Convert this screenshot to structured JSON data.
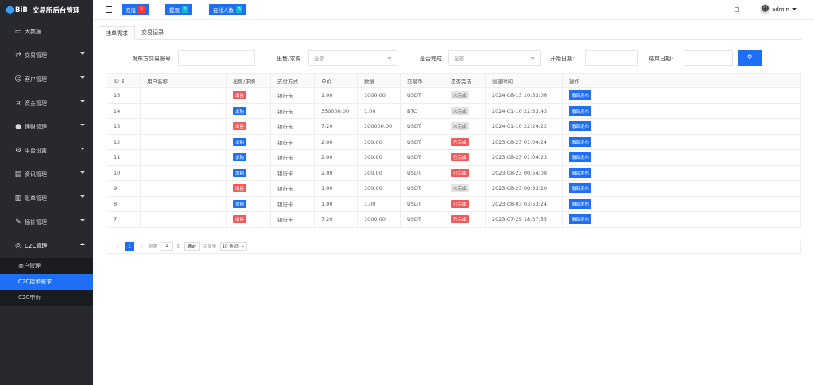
{
  "brand": {
    "logo_text": "BiB",
    "title": "交易所后台管理"
  },
  "sidebar": {
    "items": [
      {
        "label": "大数据",
        "icon": "monitor-icon",
        "has_children": false
      },
      {
        "label": "交易管理",
        "icon": "exchange-icon",
        "has_children": true
      },
      {
        "label": "客户管理",
        "icon": "users-icon",
        "has_children": true
      },
      {
        "label": "资金管理",
        "icon": "money-icon",
        "has_children": true
      },
      {
        "label": "理财管理",
        "icon": "piggy-bank-icon",
        "has_children": true
      },
      {
        "label": "平台设置",
        "icon": "settings-icon",
        "has_children": true
      },
      {
        "label": "资讯管理",
        "icon": "news-icon",
        "has_children": true
      },
      {
        "label": "账单管理",
        "icon": "bill-icon",
        "has_children": true
      },
      {
        "label": "插针管理",
        "icon": "pin-icon",
        "has_children": true
      },
      {
        "label": "C2C管理",
        "icon": "c2c-icon",
        "has_children": true,
        "open": true
      }
    ],
    "sub_items": [
      {
        "label": "商户管理",
        "active": false
      },
      {
        "label": "C2C挂单需求",
        "active": true
      },
      {
        "label": "C2C申诉",
        "active": false
      }
    ]
  },
  "topbar": {
    "recharge_label": "充值",
    "recharge_count": "3",
    "withdraw_label": "提现",
    "withdraw_count": "1",
    "online_label": "在线人数",
    "online_count": "0",
    "user": "admin"
  },
  "tabs": [
    "挂单需求",
    "交易记录"
  ],
  "filters": {
    "account_label": "发布方交易账号",
    "account_value": "",
    "type_label": "出售/求购",
    "type_value": "全部",
    "done_label": "是否完成",
    "done_value": "全部",
    "start_label": "开始日期:",
    "end_label": "结束日期:"
  },
  "table": {
    "headers": [
      "ID ⇕",
      "用户名称",
      "出售/求购",
      "支付方式",
      "单价",
      "数量",
      "交易币",
      "是否完成",
      "创建时间",
      "操作"
    ],
    "rows": [
      {
        "id": "15",
        "user": "",
        "side": "出售",
        "side_type": "sell",
        "pay": "银行卡",
        "price": "1.00",
        "qty": "1000.00",
        "coin": "USDT",
        "done": "未完成",
        "done_type": "no",
        "time": "2024-08-13 10:53:06",
        "action": "撤回发布"
      },
      {
        "id": "14",
        "user": "",
        "side": "求购",
        "side_type": "buy",
        "pay": "银行卡",
        "price": "350000.00",
        "qty": "1.00",
        "coin": "BTC",
        "done": "未完成",
        "done_type": "no",
        "time": "2024-01-10 22:33:43",
        "action": "撤回发布"
      },
      {
        "id": "13",
        "user": "",
        "side": "出售",
        "side_type": "sell",
        "pay": "银行卡",
        "price": "7.20",
        "qty": "100000.00",
        "coin": "USDT",
        "done": "未完成",
        "done_type": "no",
        "time": "2024-01-10 22:24:22",
        "action": "撤回发布"
      },
      {
        "id": "12",
        "user": "",
        "side": "求购",
        "side_type": "buy",
        "pay": "银行卡",
        "price": "2.00",
        "qty": "100.00",
        "coin": "USDT",
        "done": "已完成",
        "done_type": "yes",
        "time": "2023-08-23 01:04:24",
        "action": "撤回发布"
      },
      {
        "id": "11",
        "user": "",
        "side": "求购",
        "side_type": "buy",
        "pay": "银行卡",
        "price": "2.00",
        "qty": "100.00",
        "coin": "USDT",
        "done": "已完成",
        "done_type": "yes",
        "time": "2023-08-23 01:04:23",
        "action": "撤回发布"
      },
      {
        "id": "10",
        "user": "",
        "side": "求购",
        "side_type": "buy",
        "pay": "银行卡",
        "price": "2.00",
        "qty": "100.00",
        "coin": "USDT",
        "done": "已完成",
        "done_type": "yes",
        "time": "2023-08-23 00:54:08",
        "action": "撤回发布"
      },
      {
        "id": "9",
        "user": "",
        "side": "出售",
        "side_type": "sell",
        "pay": "银行卡",
        "price": "1.00",
        "qty": "100.00",
        "coin": "USDT",
        "done": "未完成",
        "done_type": "no",
        "time": "2023-08-23 00:53:10",
        "action": "撤回发布"
      },
      {
        "id": "8",
        "user": "",
        "side": "求购",
        "side_type": "buy",
        "pay": "银行卡",
        "price": "1.00",
        "qty": "1.00",
        "coin": "USDT",
        "done": "已完成",
        "done_type": "yes",
        "time": "2023-08-03 03:53:24",
        "action": "撤回发布"
      },
      {
        "id": "7",
        "user": "",
        "side": "出售",
        "side_type": "sell",
        "pay": "银行卡",
        "price": "7.20",
        "qty": "1000.00",
        "coin": "USDT",
        "done": "已完成",
        "done_type": "yes",
        "time": "2023-07-29 18:37:55",
        "action": "撤回发布"
      }
    ]
  },
  "pager": {
    "current": "1",
    "goto_label": "到第",
    "goto_value": "1",
    "page_unit": "页",
    "confirm": "确定",
    "total": "共 9 条",
    "page_size": "10 条/页"
  },
  "colors": {
    "accent": "#1e6ff5",
    "sidebar_bg": "#27292e",
    "danger": "#f05a5a"
  }
}
